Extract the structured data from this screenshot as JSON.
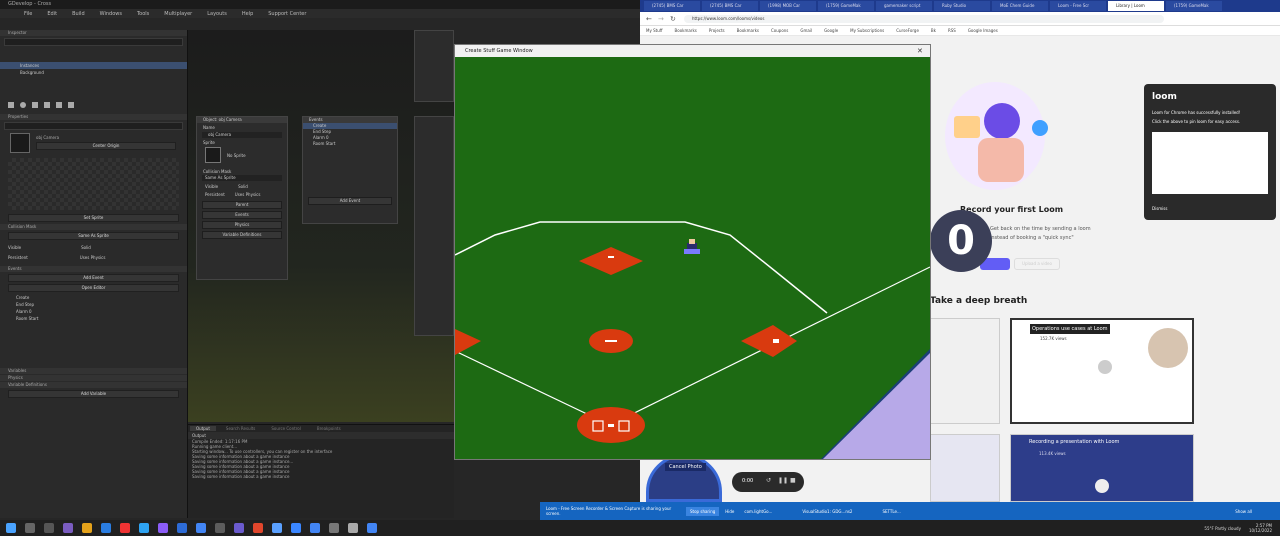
{
  "editor": {
    "title": "GDevelop - Cross ",
    "menu": [
      "File",
      "Edit",
      "Build",
      "Windows",
      "Tools",
      "Multiplayer",
      "Layouts",
      "Help",
      "Support Center"
    ],
    "scene_panel_title": "Inspector",
    "layers": [
      "Instances",
      "Background"
    ],
    "properties_title": "Properties",
    "object_name": "obj Camera",
    "center_origin": "Center Origin",
    "set_sprite": "Set Sprite",
    "collision_mask": "Collision Mask",
    "same_as_sprite": "Same As Sprite",
    "visible": "Visible",
    "solid": "Solid",
    "persistent": "Persistent",
    "uses_physics": "Uses Physics",
    "events_title": "Events",
    "add_event": "Add Event",
    "open_editor": "Open Editor",
    "events": [
      "Create",
      "End Step",
      "Alarm 0",
      "Room Start"
    ],
    "variables_title": "Variables",
    "physics_title": "Physics",
    "vars_title": "Variable Definitions",
    "add_variable": "Add Variable"
  },
  "node_panel": {
    "title": "Object: obj Camera",
    "name_label": "Name",
    "name_value": "obj Camera",
    "sprite_label": "Sprite",
    "no_sprite": "No Sprite",
    "collision_title": "Collision Mask",
    "collision_value": "Same As Sprite",
    "visible": "Visible",
    "solid": "Solid",
    "persistent": "Persistent",
    "uses_physics": "Uses Physics",
    "parent": "Parent",
    "events": "Events",
    "physics": "Physics",
    "variable_definitions": "Variable Definitions"
  },
  "events_node": {
    "title": "Events",
    "items": [
      "Create",
      "End Step",
      "Alarm 0",
      "Room Start"
    ],
    "add_event": "Add Event"
  },
  "output": {
    "tabs": [
      "Output",
      "Search Results",
      "Source Control",
      "Breakpoints"
    ],
    "header": "Output",
    "lines": [
      "Compile Ended: 1:17:16 PM",
      "Running game client...",
      "Starting window... To use controllers, you can register on the interface",
      "Saving some information about a game instance",
      "Saving some information about a game instance...",
      "Saving some information about a game instance",
      "Saving some information about a game instance",
      "Saving some information about a game instance"
    ]
  },
  "game": {
    "title": "Create Stuff Game Window"
  },
  "browser": {
    "tabs": [
      "(2745) BMS Car",
      "(2745) BMS Car",
      "(1998) MOB Car",
      "(1759) GameMak",
      "gamemaker script",
      "Ruby Studio",
      "MoE Chem Guide",
      "Loom - Free Scr",
      "Library | Loom",
      "(1759) GameMak"
    ],
    "active_tab": 8,
    "url": "https://www.loom.com/looms/videos",
    "bookmarks": [
      "My Stuff",
      "Bookmarks",
      "Projects",
      "Bookmarks",
      "Coupons",
      "Gmail",
      "Google",
      "My Subscriptions",
      "CurseForge",
      "Bk",
      "RSS",
      "Google Images"
    ],
    "loom_logo": "loom",
    "heading": "Record your first Loom",
    "subtext_1": "Get back on the time by sending a loom",
    "subtext_2": "instead of booking a \"quick sync\"",
    "upload_button": "Upload a video",
    "breath": "Take a deep breath",
    "countdown": "0",
    "cards": [
      {
        "title": "Operations use cases at Loom",
        "views": "152.7K views"
      },
      {
        "title": "Recording a presentation with Loom",
        "views": "113.4K views"
      }
    ],
    "popup": {
      "logo": "loom",
      "text_1": "Loom for Chrome has successfully installed!",
      "text_2": "Click the  above to pin loom for easy access.",
      "dismiss": "Dismiss"
    },
    "camera_btn": "Cancel Photo",
    "recorder_time": "0:00"
  },
  "win_taskbar": {
    "loom_text": "Loom - Free Screen Recorder & Screen Capture is sharing your screen.",
    "stop_sharing": "Stop sharing",
    "hide": "Hide",
    "item_1": "com.lightGo...",
    "item_2": "VisualStudio1: GDG...ns2",
    "item_3": "SETTLe...",
    "show_all": "Show all"
  },
  "system_tray": {
    "weather": "55°F Partly cloudy",
    "time": "2:57 PM",
    "date": "10/12/2022"
  },
  "colors": {
    "field_green": "#1d6a13",
    "base_red": "#d93a0f",
    "loom_blue": "#625df5",
    "taskbar_blue": "#1565c0"
  }
}
